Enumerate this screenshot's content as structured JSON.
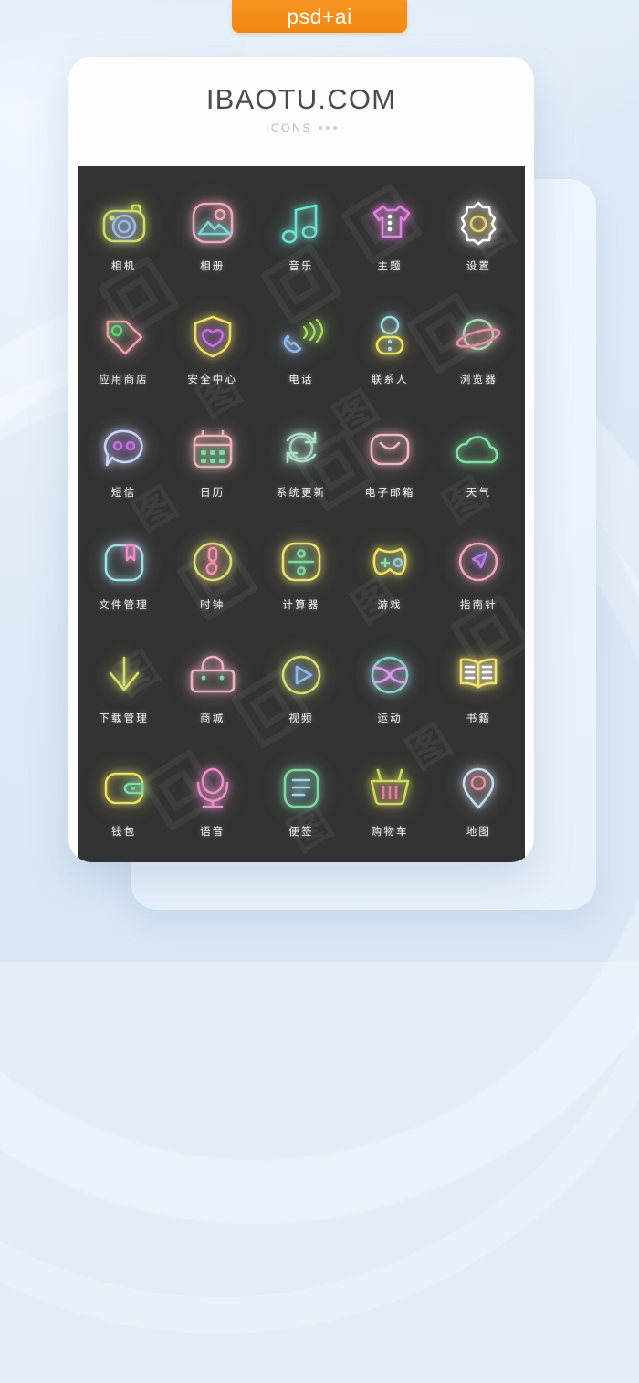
{
  "badge": {
    "label": "psd+ai",
    "color": "#f2870f"
  },
  "card": {
    "brand": "IBAOTU.COM",
    "subtitle": "ICONS",
    "dots_count": 3
  },
  "screen": {
    "background": "#333333",
    "watermark_text": "图",
    "label_color": "#f2f2f2",
    "columns": 5,
    "rows": 6
  },
  "icons": [
    {
      "name": "camera-icon",
      "label": "相机",
      "outer": "#cfe05a",
      "inner": "#9fb8e0"
    },
    {
      "name": "photo-album-icon",
      "label": "相册",
      "outer": "#f0a8b8",
      "inner": "#7fd4cf"
    },
    {
      "name": "music-icon",
      "label": "音乐",
      "outer": "#6fe0d2",
      "inner": "#6fe0d2"
    },
    {
      "name": "theme-shirt-icon",
      "label": "主题",
      "outer": "#e07fe0",
      "inner": "#ffffff"
    },
    {
      "name": "settings-gear-icon",
      "label": "设置",
      "outer": "#ffffff",
      "inner": "#e8cf6a"
    },
    {
      "name": "app-store-tag-icon",
      "label": "应用商店",
      "outer": "#f0a0a8",
      "inner": "#5fd07a"
    },
    {
      "name": "security-shield-icon",
      "label": "安全中心",
      "outer": "#f0e060",
      "inner": "#c070e8"
    },
    {
      "name": "phone-icon",
      "label": "电话",
      "outer": "#8fb8e8",
      "inner": "#a8e060"
    },
    {
      "name": "contacts-icon",
      "label": "联系人",
      "outer": "#f0e060",
      "inner": "#9fd8e8"
    },
    {
      "name": "browser-planet-icon",
      "label": "浏览器",
      "outer": "#9fe0b0",
      "inner": "#e88fa8"
    },
    {
      "name": "sms-message-icon",
      "label": "短信",
      "outer": "#c8d8f8",
      "inner": "#c070e8"
    },
    {
      "name": "calendar-icon",
      "label": "日历",
      "outer": "#f0b0b8",
      "inner": "#7fd8a0"
    },
    {
      "name": "system-update-icon",
      "label": "系统更新",
      "outer": "#b0ddc8",
      "inner": "#5fd08a"
    },
    {
      "name": "email-icon",
      "label": "电子邮箱",
      "outer": "#f0b8c0",
      "inner": "#f0b8c0"
    },
    {
      "name": "weather-cloud-icon",
      "label": "天气",
      "outer": "#7fe0a0",
      "inner": "#7fe0a0"
    },
    {
      "name": "file-manager-icon",
      "label": "文件管理",
      "outer": "#9fe0e8",
      "inner": "#e88fc8"
    },
    {
      "name": "clock-icon",
      "label": "时钟",
      "outer": "#d8e070",
      "inner": "#f090a8"
    },
    {
      "name": "calculator-icon",
      "label": "计算器",
      "outer": "#f0e070",
      "inner": "#7fd8a0"
    },
    {
      "name": "game-controller-icon",
      "label": "游戏",
      "outer": "#f0e060",
      "inner": "#8fd8a8"
    },
    {
      "name": "compass-icon",
      "label": "指南针",
      "outer": "#f0a8b8",
      "inner": "#b07fe8"
    },
    {
      "name": "download-manager-icon",
      "label": "下载管理",
      "outer": "#d8e070",
      "inner": "#d8e070"
    },
    {
      "name": "mall-bag-icon",
      "label": "商城",
      "outer": "#f0b0c0",
      "inner": "#7fd8a0"
    },
    {
      "name": "video-play-icon",
      "label": "视频",
      "outer": "#d8e070",
      "inner": "#8fb8e8"
    },
    {
      "name": "sports-ball-icon",
      "label": "运动",
      "outer": "#7fd8c8",
      "inner": "#d89fe8"
    },
    {
      "name": "books-icon",
      "label": "书籍",
      "outer": "#f0e060",
      "inner": "#ffffff"
    },
    {
      "name": "wallet-icon",
      "label": "钱包",
      "outer": "#f0e060",
      "inner": "#7fd8a0"
    },
    {
      "name": "voice-mic-icon",
      "label": "语音",
      "outer": "#e88fc8",
      "inner": "#e88fc8"
    },
    {
      "name": "notes-icon",
      "label": "便签",
      "outer": "#7fd8a0",
      "inner": "#9fd8e8"
    },
    {
      "name": "shopping-basket-icon",
      "label": "购物车",
      "outer": "#cfe05a",
      "inner": "#e07f9f"
    },
    {
      "name": "map-pin-icon",
      "label": "地图",
      "outer": "#c8e0f0",
      "inner": "#e0909f"
    }
  ]
}
